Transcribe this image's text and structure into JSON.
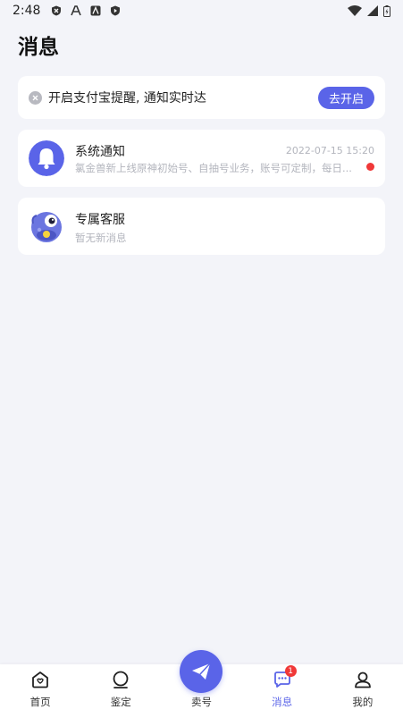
{
  "status_bar": {
    "time": "2:48"
  },
  "page": {
    "title": "消息"
  },
  "notice": {
    "text": "开启支付宝提醒, 通知实时达",
    "button_label": "去开启"
  },
  "messages": [
    {
      "title": "系统通知",
      "time": "2022-07-15 15:20",
      "preview": "氯金兽新上线原神初始号、自抽号业务，账号可定制，每日...",
      "unread": true,
      "avatar_icon": "bell-icon"
    },
    {
      "title": "专属客服",
      "time": "",
      "preview": "暂无新消息",
      "unread": false,
      "avatar_icon": "mascot-avatar"
    }
  ],
  "tabbar": {
    "items": [
      {
        "label": "首页",
        "icon": "home-icon",
        "active": false
      },
      {
        "label": "鉴定",
        "icon": "appraise-icon",
        "active": false
      },
      {
        "label": "卖号",
        "icon": "send-icon",
        "active": false
      },
      {
        "label": "消息",
        "icon": "message-icon",
        "active": true,
        "badge": "1"
      },
      {
        "label": "我的",
        "icon": "profile-icon",
        "active": false
      }
    ]
  },
  "colors": {
    "accent": "#5a64e8",
    "background": "#f3f4f9",
    "unread": "#f03838"
  }
}
